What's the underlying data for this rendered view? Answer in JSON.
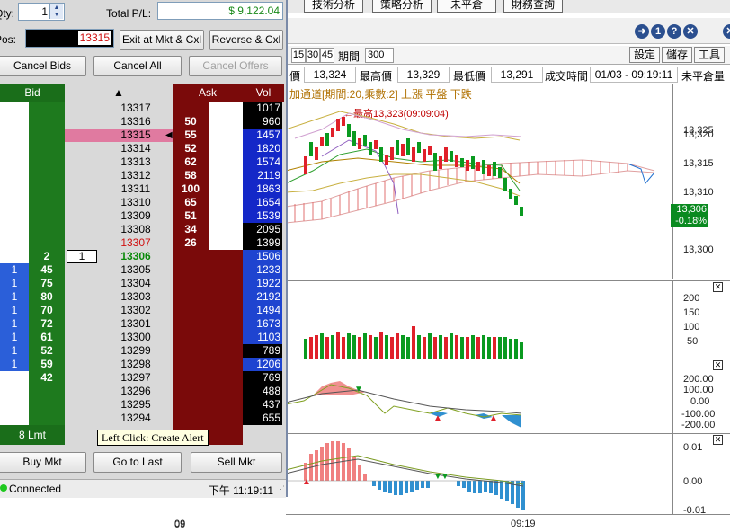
{
  "dom": {
    "qty_label": "Qty:",
    "qty_value": "1",
    "total_pl_label": "Total P/L:",
    "total_pl_value": "$ 9,122.04",
    "pos_label": "Pos:",
    "pos_value": "13315",
    "exit_btn": "Exit at Mkt & Cxl",
    "reverse_btn": "Reverse & Cxl",
    "cancel_bids_btn": "Cancel Bids",
    "cancel_all_btn": "Cancel All",
    "cancel_offers_btn": "Cancel Offers",
    "bid_header": "Bid",
    "ask_header": "Ask",
    "vol_header": "Vol",
    "lmt_label": "8 Lmt",
    "buy_mkt_btn": "Buy Mkt",
    "go_last_btn": "Go to Last",
    "sell_mkt_btn": "Sell Mkt",
    "status_text": "Connected",
    "time_text": "下午 11:19:11",
    "tooltip": "Left Click: Create Alert",
    "rows": [
      {
        "price": "13317",
        "ask": "",
        "vol": "1017",
        "bidq": "",
        "bid": "",
        "pcol": "#000"
      },
      {
        "price": "13316",
        "ask": "50",
        "vol": "960",
        "bidq": "",
        "bid": "",
        "pcol": "#000"
      },
      {
        "price": "13315",
        "ask": "55",
        "vol": "1457",
        "bidq": "",
        "bid": "",
        "pcol": "#000"
      },
      {
        "price": "13314",
        "ask": "52",
        "vol": "1820",
        "bidq": "",
        "bid": "",
        "pcol": "#000"
      },
      {
        "price": "13313",
        "ask": "62",
        "vol": "1574",
        "bidq": "",
        "bid": "",
        "pcol": "#000"
      },
      {
        "price": "13312",
        "ask": "58",
        "vol": "2119",
        "bidq": "",
        "bid": "",
        "pcol": "#000"
      },
      {
        "price": "13311",
        "ask": "100",
        "vol": "1863",
        "bidq": "",
        "bid": "",
        "pcol": "#000"
      },
      {
        "price": "13310",
        "ask": "65",
        "vol": "1654",
        "bidq": "",
        "bid": "",
        "pcol": "#000"
      },
      {
        "price": "13309",
        "ask": "51",
        "vol": "1539",
        "bidq": "",
        "bid": "",
        "pcol": "#000"
      },
      {
        "price": "13308",
        "ask": "34",
        "vol": "2095",
        "bidq": "",
        "bid": "",
        "pcol": "#000"
      },
      {
        "price": "13307",
        "ask": "26",
        "vol": "1399",
        "bidq": "",
        "bid": "",
        "pcol": "#d01010"
      },
      {
        "price": "13306",
        "ask": "",
        "vol": "1506",
        "bidq": "",
        "bid": "2",
        "pcol": "#0a8a0a",
        "myorder": "1"
      },
      {
        "price": "13305",
        "ask": "",
        "vol": "1233",
        "bidq": "1",
        "bid": "45",
        "pcol": "#000"
      },
      {
        "price": "13304",
        "ask": "",
        "vol": "1922",
        "bidq": "1",
        "bid": "75",
        "pcol": "#000"
      },
      {
        "price": "13303",
        "ask": "",
        "vol": "2192",
        "bidq": "1",
        "bid": "80",
        "pcol": "#000"
      },
      {
        "price": "13302",
        "ask": "",
        "vol": "1494",
        "bidq": "1",
        "bid": "70",
        "pcol": "#000"
      },
      {
        "price": "13301",
        "ask": "",
        "vol": "1673",
        "bidq": "1",
        "bid": "72",
        "pcol": "#000"
      },
      {
        "price": "13300",
        "ask": "",
        "vol": "1103",
        "bidq": "1",
        "bid": "61",
        "pcol": "#000"
      },
      {
        "price": "13299",
        "ask": "",
        "vol": "789",
        "bidq": "1",
        "bid": "52",
        "pcol": "#000"
      },
      {
        "price": "13298",
        "ask": "",
        "vol": "1206",
        "bidq": "1",
        "bid": "59",
        "pcol": "#000"
      },
      {
        "price": "13297",
        "ask": "",
        "vol": "769",
        "bidq": "",
        "bid": "42",
        "pcol": "#000"
      },
      {
        "price": "13296",
        "ask": "",
        "vol": "488",
        "bidq": "",
        "bid": "",
        "pcol": "#000"
      },
      {
        "price": "13295",
        "ask": "",
        "vol": "437",
        "bidq": "",
        "bid": "",
        "pcol": "#000"
      },
      {
        "price": "13294",
        "ask": "",
        "vol": "655",
        "bidq": "",
        "bid": "",
        "pcol": "#000"
      }
    ]
  },
  "chart": {
    "tabs": [
      "技術分析",
      "策略分析",
      "未平倉",
      "財務查詢"
    ],
    "periods": [
      "15",
      "30",
      "45"
    ],
    "period_label": "期間",
    "period_value": "300",
    "settings_btn": "設定",
    "save_btn": "儲存",
    "tools_btn": "工具",
    "quote_labels": [
      "價",
      "最高價",
      "最低價",
      "成交時間",
      "未平倉量"
    ],
    "quote_values": [
      "13,324",
      "13,329",
      "13,291",
      "01/03 - 09:19:11"
    ],
    "indicator_title": "加通道[期間:20,乘數:2] 上漲  平盤  下跌",
    "high_annotation": "←最高13,323(09:09:04)",
    "price_axis": [
      "13,325",
      "13,320",
      "13,315",
      "13,310",
      "13,300"
    ],
    "last_price": "13,306",
    "last_change": "-0.18%",
    "vol_axis": [
      "200",
      "150",
      "100",
      "50"
    ],
    "osc_axis": [
      "200.00",
      "100.00",
      "0.00",
      "-100.00",
      "-200.00"
    ],
    "macd_axis": [
      "0.01",
      "0.00",
      "-0.01"
    ],
    "x_labels": [
      "09",
      "09:19"
    ],
    "close_icon": "✕",
    "colors": {
      "up": "#e0202a",
      "down": "#0a9a20",
      "accent": "#2b4f8f"
    }
  }
}
